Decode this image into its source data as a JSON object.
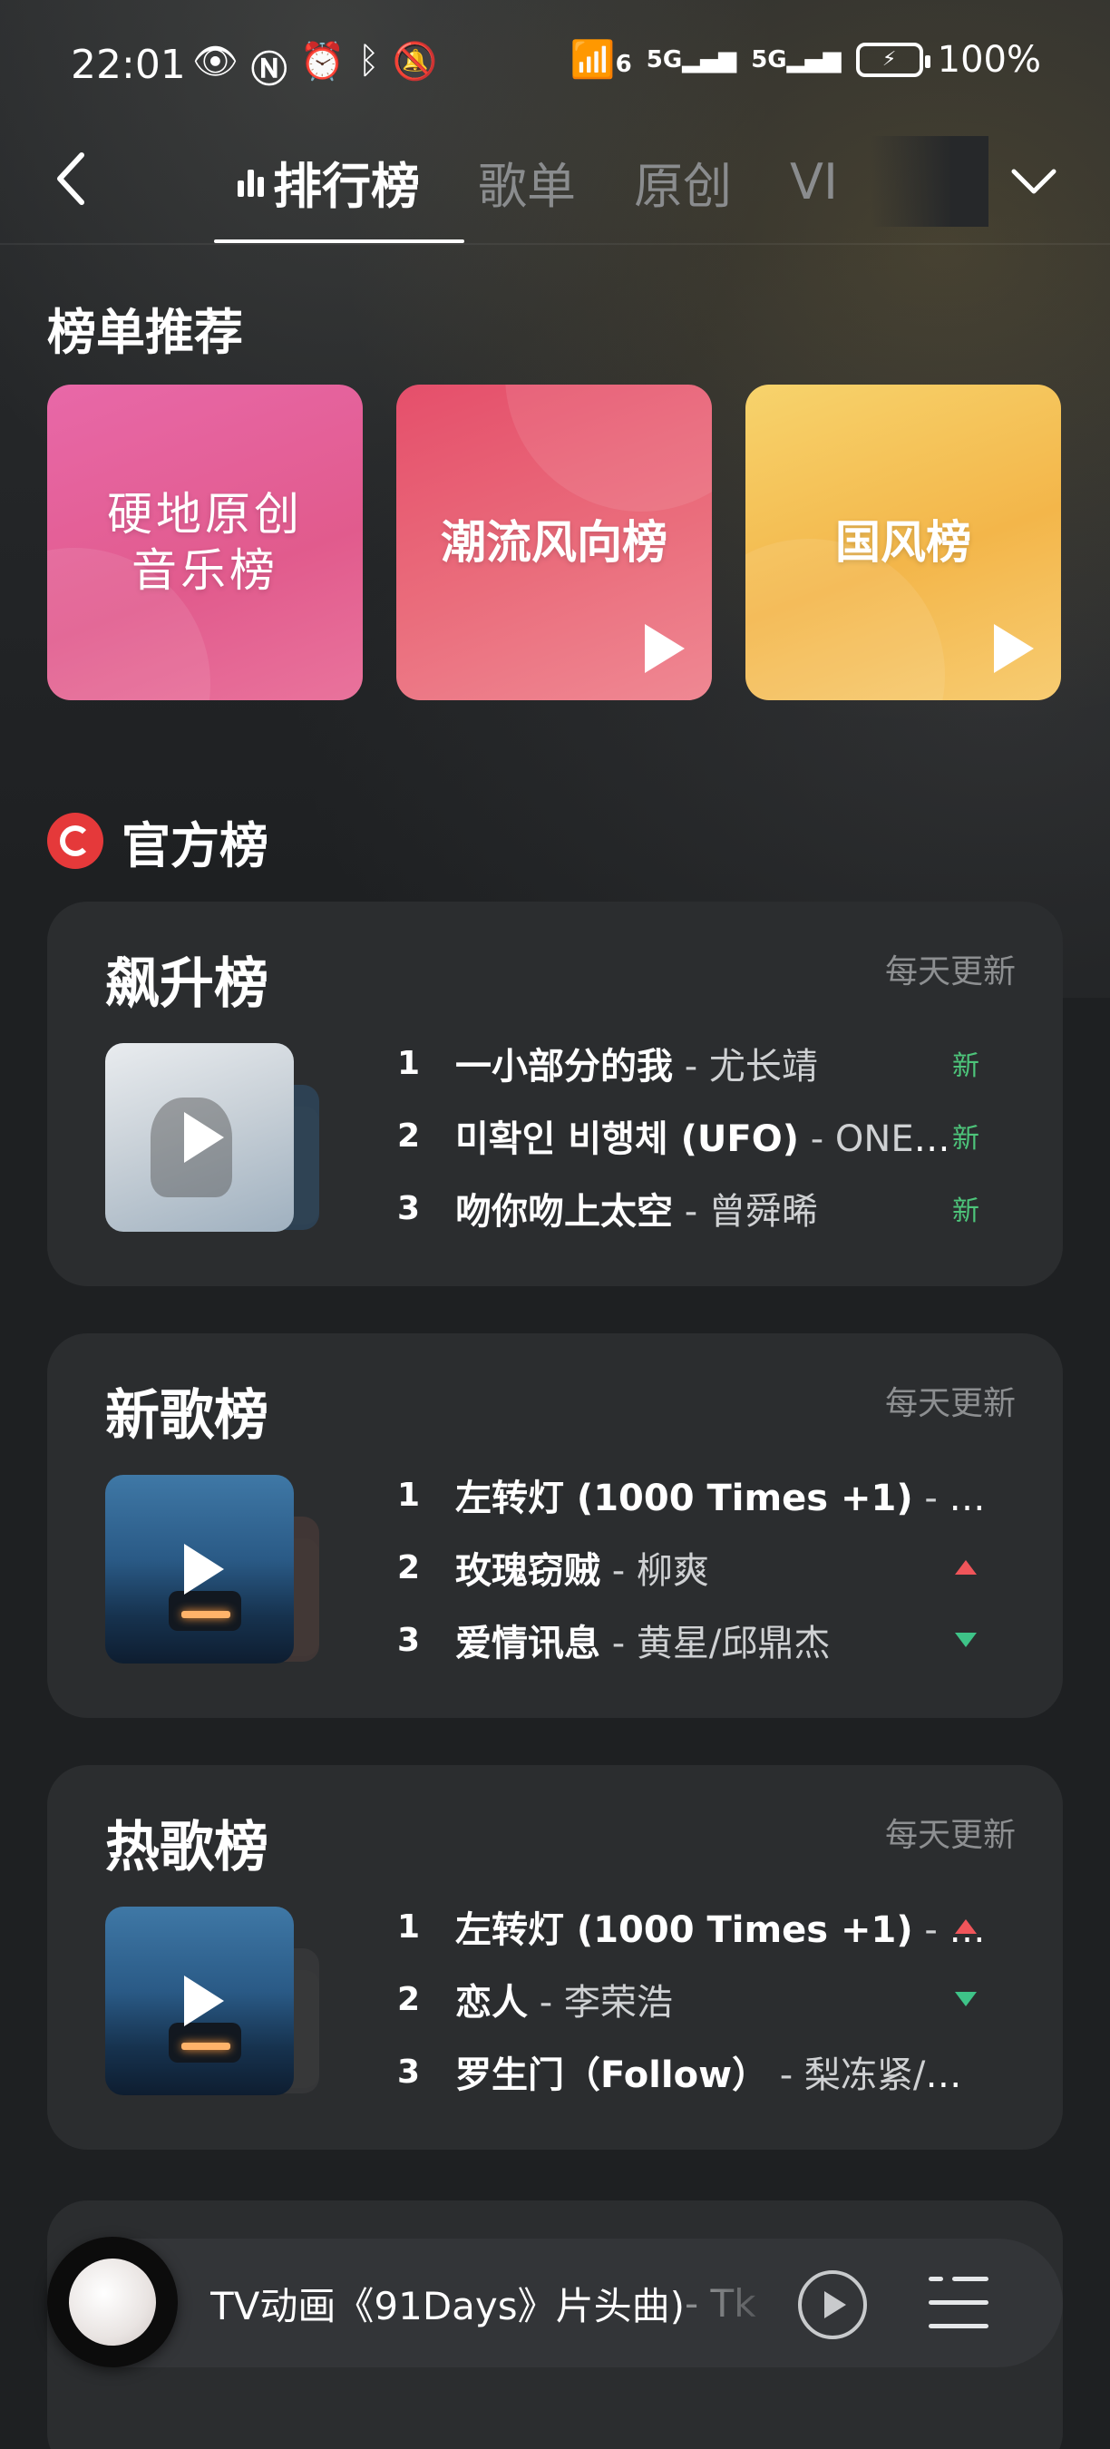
{
  "status_bar": {
    "time": "22:01",
    "battery_text": "100%",
    "signal_1": "5G",
    "signal_2": "5G",
    "wifi": "6"
  },
  "nav": {
    "tabs": [
      {
        "label": "排行榜",
        "active": true
      },
      {
        "label": "歌单",
        "active": false
      },
      {
        "label": "原创",
        "active": false
      },
      {
        "label": "VI",
        "active": false
      }
    ]
  },
  "recommend": {
    "title": "榜单推荐",
    "cards": [
      {
        "label_line1": "硬地原创",
        "label_line2": "音乐榜"
      },
      {
        "label_line1": "潮流风向榜",
        "label_line2": ""
      },
      {
        "label_line1": "国风榜",
        "label_line2": ""
      }
    ]
  },
  "official": {
    "title": "官方榜",
    "charts": [
      {
        "title": "飙升榜",
        "update": "每天更新",
        "songs": [
          {
            "rank": "1",
            "name": "一小部分的我",
            "sep": " - ",
            "artist": "尤长靖",
            "trend": "新"
          },
          {
            "rank": "2",
            "name": "미확인 비행체 (UFO)",
            "sep": " - ",
            "artist": "ONEWE",
            "trend": "新"
          },
          {
            "rank": "3",
            "name": "吻你吻上太空",
            "sep": " - ",
            "artist": "曾舜晞",
            "trend": "新"
          }
        ]
      },
      {
        "title": "新歌榜",
        "update": "每天更新",
        "songs": [
          {
            "rank": "1",
            "name": "左转灯 (1000 Times +1)",
            "sep": " - ",
            "artist": "派…",
            "trend": ""
          },
          {
            "rank": "2",
            "name": "玫瑰窃贼",
            "sep": " - ",
            "artist": "柳爽",
            "trend": "up"
          },
          {
            "rank": "3",
            "name": "爱情讯息",
            "sep": " - ",
            "artist": "黄星/邱鼎杰",
            "trend": "down"
          }
        ]
      },
      {
        "title": "热歌榜",
        "update": "每天更新",
        "songs": [
          {
            "rank": "1",
            "name": "左转灯 (1000 Times +1)",
            "sep": " - ",
            "artist": "派…",
            "trend": "up"
          },
          {
            "rank": "2",
            "name": "恋人",
            "sep": " - ",
            "artist": "李荣浩",
            "trend": "down"
          },
          {
            "rank": "3",
            "name": "罗生门（Follow）",
            "sep": " - ",
            "artist": "梨冻紧/W…",
            "trend": ""
          }
        ]
      }
    ]
  },
  "player": {
    "title": "TV动画《91Days》片头曲)",
    "artist_tail": " - Tk"
  },
  "colors": {
    "background": "#1e2022",
    "card": "#2b2d2f",
    "new_badge": "#4dc47a",
    "trend_up": "#f0555a",
    "trend_down": "#3ec388",
    "official_logo": "#e5393a"
  }
}
